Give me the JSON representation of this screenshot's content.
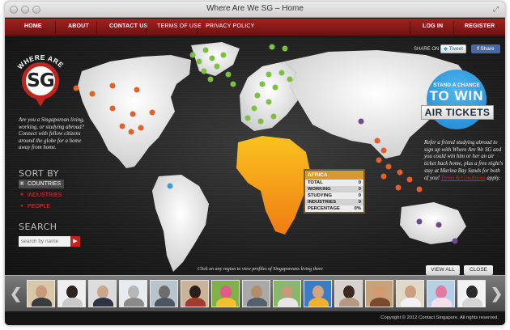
{
  "window": {
    "title": "Where Are We SG – Home"
  },
  "nav": {
    "home": "HOME",
    "about": "ABOUT",
    "contact": "CONTACT US",
    "terms": "TERMS OF USE",
    "privacy": "PRIVACY POLICY",
    "login": "LOG IN",
    "register": "REGISTER"
  },
  "logo": {
    "arc_text": "WHERE ARE WE",
    "mark": "SG"
  },
  "intro_text": "Are you a Singaporean living, working, or studying abroad? Connect with fellow citizens around the globe for a home away from home.",
  "sort": {
    "heading": "SORT BY",
    "options": [
      "COUNTRIES",
      "INDUSTRIES",
      "PEOPLE"
    ]
  },
  "search": {
    "heading": "SEARCH",
    "placeholder": "search by name",
    "button_icon": "arrow-right-icon"
  },
  "share": {
    "label": "SHARE ON",
    "tweet": "Tweet",
    "facebook": "Share"
  },
  "contest": {
    "line1": "STAND A CHANCE",
    "line2": "TO WIN",
    "ribbon": "AIR TICKETS",
    "text": "Refer a friend studying abroad to sign up with Where Are We SG and you could win him or her an air ticket back home, plus a free night's stay at Marina Bay Sands for both of you!",
    "terms_link": "Terms & Conditions",
    "terms_suffix": "apply."
  },
  "region_stats": {
    "region": "AFRICA",
    "rows": [
      {
        "label": "TOTAL",
        "value": "0"
      },
      {
        "label": "WORKING",
        "value": "0"
      },
      {
        "label": "STUDYING",
        "value": "0"
      },
      {
        "label": "INDUSTRIES",
        "value": "0"
      },
      {
        "label": "PERCENTAGE",
        "value": "0%"
      }
    ]
  },
  "map_hint": "Click on any region to view profiles of Singaporeans living there",
  "buttons": {
    "view_all": "VIEW ALL",
    "close": "CLOSE"
  },
  "colors": {
    "accent_red": "#c0241f",
    "africa": "#f0a21c",
    "contest_blue": "#1d86cf"
  },
  "copyright": "Copyright © 2012 Contact Singapore. All rights reserved."
}
